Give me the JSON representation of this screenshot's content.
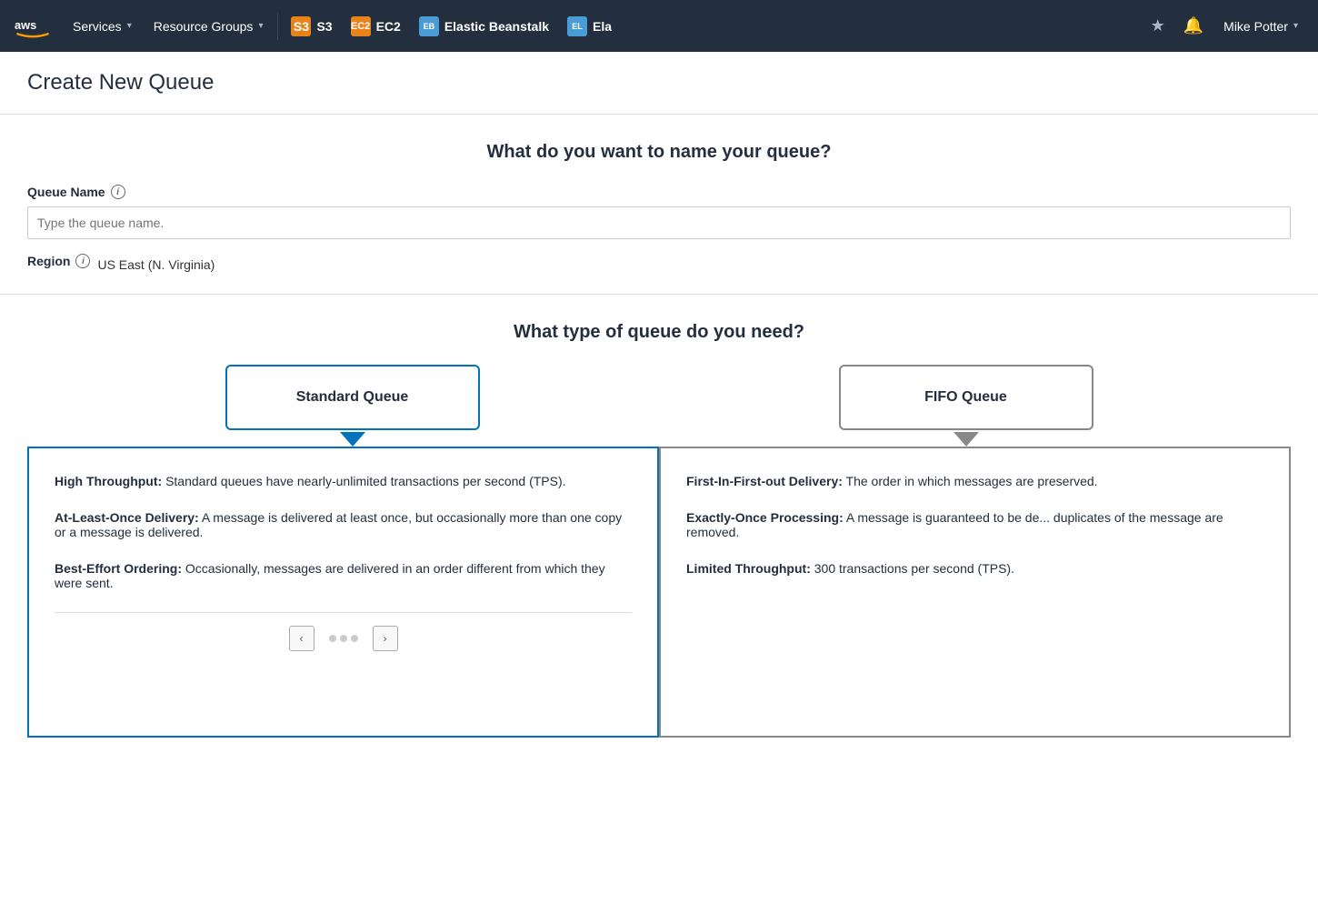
{
  "navbar": {
    "logo_alt": "AWS",
    "services_label": "Services",
    "resource_groups_label": "Resource Groups",
    "s3_label": "S3",
    "ec2_label": "EC2",
    "elastic_beanstalk_label": "Elastic Beanstalk",
    "ela_label": "Ela",
    "pin_icon": "★",
    "bell_icon": "🔔",
    "user_label": "Mike Potter",
    "chevron": "▾"
  },
  "page": {
    "title": "Create New Queue"
  },
  "queue_name_section": {
    "heading": "What do you want to name your queue?",
    "field_label": "Queue Name",
    "input_placeholder": "Type the queue name.",
    "region_label": "Region",
    "region_value": "US East (N. Virginia)"
  },
  "queue_type_section": {
    "heading": "What type of queue do you need?",
    "standard_queue_label": "Standard Queue",
    "fifo_queue_label": "FIFO Queue",
    "standard_features": [
      {
        "title": "High Throughput:",
        "desc": " Standard queues have nearly-unlimited transactions per second (TPS)."
      },
      {
        "title": "At-Least-Once Delivery:",
        "desc": " A message is delivered at least once, but occasionally more than one copy or a message is delivered."
      },
      {
        "title": "Best-Effort Ordering:",
        "desc": " Occasionally, messages are delivered in an order different from which they were sent."
      }
    ],
    "fifo_features": [
      {
        "title": "First-In-First-out Delivery:",
        "desc": " The order in which messages are preserved."
      },
      {
        "title": "Exactly-Once Processing:",
        "desc": " A message is guaranteed to be de... duplicates of the message are removed."
      },
      {
        "title": "Limited Throughput:",
        "desc": " 300 transactions per second (TPS)."
      }
    ]
  },
  "colors": {
    "selected_border": "#0073bb",
    "unselected_border": "#888888",
    "nav_bg": "#232f3e"
  }
}
